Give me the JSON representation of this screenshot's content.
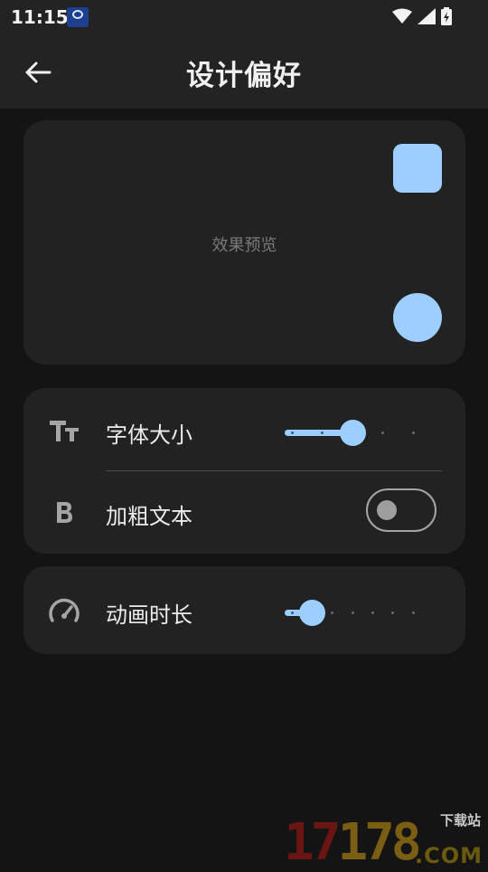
{
  "status_bar": {
    "time": "11:15"
  },
  "app_bar": {
    "title": "设计偏好",
    "back_icon": "arrow-left-icon"
  },
  "preview": {
    "label": "效果预览",
    "shape_color": "#9ccfff"
  },
  "settings": {
    "font_size": {
      "label": "字体大小",
      "icon": "text-size-icon",
      "value_fraction": 0.5,
      "steps": 5
    },
    "bold_text": {
      "label": "加粗文本",
      "icon": "bold-icon",
      "enabled": false
    }
  },
  "animation": {
    "label": "动画时长",
    "icon": "speedometer-icon",
    "value_fraction": 0.17,
    "steps": 7
  },
  "watermark": {
    "digits": "17178",
    "domain": ".COM",
    "subtitle": "下载站"
  },
  "colors": {
    "accent": "#9ccfff",
    "card": "#222222",
    "background": "#141414"
  }
}
